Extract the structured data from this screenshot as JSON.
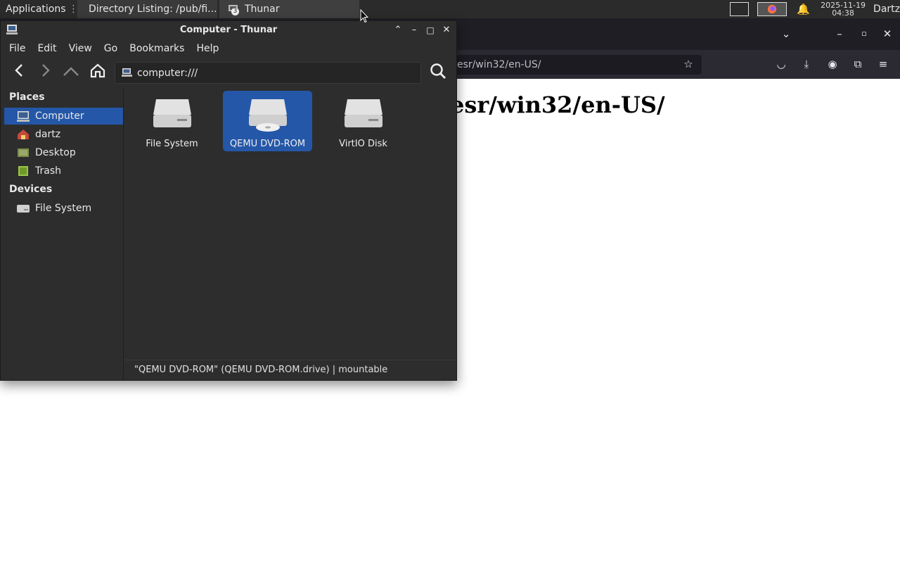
{
  "panel": {
    "applications_label": "Applications",
    "tasks": [
      {
        "label": "Directory Listing: /pub/fi...",
        "icon": "firefox-icon"
      },
      {
        "label": "Thunar",
        "icon": "file-manager-icon",
        "badge": "3"
      }
    ],
    "clock_date": "2025-11-19",
    "clock_time": "04:38",
    "user": "Dartz"
  },
  "browser": {
    "url": "esr/win32/en-US/",
    "heading": "esr/win32/en-US/"
  },
  "thunar": {
    "title": "Computer - Thunar",
    "menu": [
      "File",
      "Edit",
      "View",
      "Go",
      "Bookmarks",
      "Help"
    ],
    "location": "computer:///",
    "sidebar": {
      "places_header": "Places",
      "places": [
        {
          "label": "Computer",
          "icon": "computer-icon",
          "selected": true
        },
        {
          "label": "dartz",
          "icon": "home-folder-icon",
          "selected": false
        },
        {
          "label": "Desktop",
          "icon": "desktop-icon",
          "selected": false
        },
        {
          "label": "Trash",
          "icon": "trash-icon",
          "selected": false
        }
      ],
      "devices_header": "Devices",
      "devices": [
        {
          "label": "File System",
          "icon": "drive-icon"
        }
      ]
    },
    "items": [
      {
        "label": "File System",
        "icon": "drive-icon",
        "selected": false
      },
      {
        "label": "QEMU DVD-ROM",
        "icon": "optical-drive-icon",
        "selected": true
      },
      {
        "label": "VirtIO Disk",
        "icon": "drive-icon",
        "selected": false
      }
    ],
    "status": "\"QEMU DVD-ROM\" (QEMU DVD-ROM.drive)  |  mountable"
  },
  "colors": {
    "selection": "#2457a8",
    "window_bg": "#2d2d2d",
    "panel_bg": "#2b2b2b"
  }
}
